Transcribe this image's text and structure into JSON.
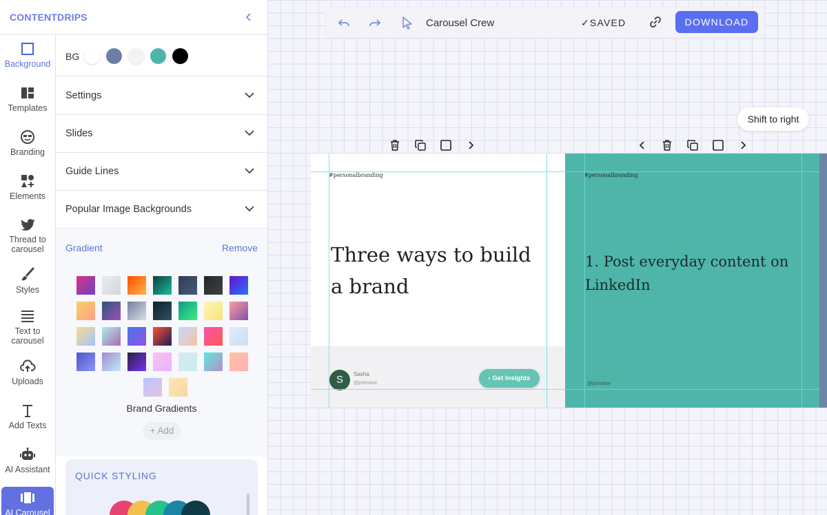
{
  "sidebar": {
    "brand": "CONTENTDRIPS",
    "collapse_icon": "chevron-left-icon",
    "rail": [
      {
        "label": "Background",
        "icon": "square-outline-icon",
        "active": true
      },
      {
        "label": "Templates",
        "icon": "templates-grid-icon"
      },
      {
        "label": "Branding",
        "icon": "sunglasses-face-icon"
      },
      {
        "label": "Elements",
        "icon": "shapes-icon"
      },
      {
        "label": "Thread to carousel",
        "icon": "twitter-bird-icon"
      },
      {
        "label": "Styles",
        "icon": "paintbrush-icon"
      },
      {
        "label": "Text to carousel",
        "icon": "text-lines-icon"
      },
      {
        "label": "Uploads",
        "icon": "cloud-upload-icon"
      },
      {
        "label": "Add Texts",
        "icon": "text-t-icon"
      },
      {
        "label": "AI Assistant",
        "icon": "robot-icon"
      },
      {
        "label": "AI Carousel",
        "icon": "carousel-icon",
        "selected": true
      }
    ]
  },
  "panel": {
    "bg_label": "BG",
    "bg_swatches": [
      "#ffffff",
      "#6b7ea8",
      "#f3f3f3",
      "#4fb5a9",
      "#000000"
    ],
    "accordions": [
      {
        "label": "Settings"
      },
      {
        "label": "Slides"
      },
      {
        "label": "Guide Lines"
      },
      {
        "label": "Popular Image Backgrounds"
      }
    ],
    "gradient": {
      "title": "Gradient",
      "remove": "Remove",
      "rows": [
        [
          "linear-gradient(135deg,#d63384,#6f42c1)",
          "linear-gradient(135deg,#e9ecef,#d3d6dc)",
          "linear-gradient(135deg,#ff4e00,#ffb347)",
          "linear-gradient(135deg,#0f3d3e,#1abc9c)",
          "linear-gradient(135deg,#2c3e50,#4a5a7a)",
          "linear-gradient(135deg,#232526,#414345)",
          "linear-gradient(135deg,#6a11cb,#2575fc)"
        ],
        [
          "linear-gradient(135deg,#f6d365,#fda085)",
          "linear-gradient(135deg,#2b5876,#9d50bb)",
          "linear-gradient(135deg,#757f9a,#d7dde8)",
          "linear-gradient(135deg,#0f2027,#2c5364)",
          "linear-gradient(135deg,#11998e,#38ef7d)",
          "linear-gradient(135deg,#fff6b7,#f6e27a)",
          "linear-gradient(135deg,#ff9a9e,#7f53ac)"
        ],
        [
          "linear-gradient(135deg,#fddb92,#a1c4fd)",
          "linear-gradient(135deg,#a8edea,#b06ab3)",
          "linear-gradient(135deg,#4776e6,#8e54e9)",
          "linear-gradient(135deg,#ff512f,#1c1c5a)",
          "linear-gradient(135deg,#c9d6ff,#f4c4a1)",
          "linear-gradient(135deg,#f857a6,#ff5858)",
          "linear-gradient(135deg,#e0eafc,#cfdef3)"
        ],
        [
          "linear-gradient(135deg,#4e54c8,#8f94fb)",
          "linear-gradient(135deg,#a18cd1,#c2e9fb)",
          "linear-gradient(135deg,#24243e,#7b2ff7)",
          "linear-gradient(135deg,#fbc2eb,#e6b3ff)",
          "linear-gradient(135deg,#dbe6f6,#c5f0e6)",
          "linear-gradient(135deg,#5ee7df,#b490ca)",
          "linear-gradient(135deg,#ffc3a0,#ffafbd)"
        ],
        [
          "linear-gradient(135deg,#b8c6ff,#e5c2e0)",
          "linear-gradient(135deg,#fde4b8,#f7d9a0)"
        ]
      ],
      "brand_label": "Brand Gradients",
      "add_label": "+ Add"
    },
    "quick_styling": {
      "label": "QUICK STYLING",
      "colors": [
        "#e8436f",
        "#f3c04e",
        "#27c28a",
        "#1a85a6",
        "#0e3b46"
      ]
    }
  },
  "toolbar": {
    "undo_icon": "undo-icon",
    "redo_icon": "redo-icon",
    "pointer_icon": "cursor-pointer-icon",
    "title": "Carousel Crew",
    "saved": "✓SAVED",
    "link_icon": "link-icon",
    "download": "DOWNLOAD"
  },
  "canvas": {
    "tooltip": "Shift to right",
    "slides": [
      {
        "hashtag": "#personalbranding",
        "headline": "Three ways to build a brand",
        "avatar_letter": "S",
        "author": "Sasha",
        "handle": "@johndoe",
        "cta": "‹  Get Insights"
      },
      {
        "hashtag": "#personalbranding",
        "headline": "1. Post everyday content on LinkedIn",
        "handle": "@johndoe"
      }
    ]
  }
}
